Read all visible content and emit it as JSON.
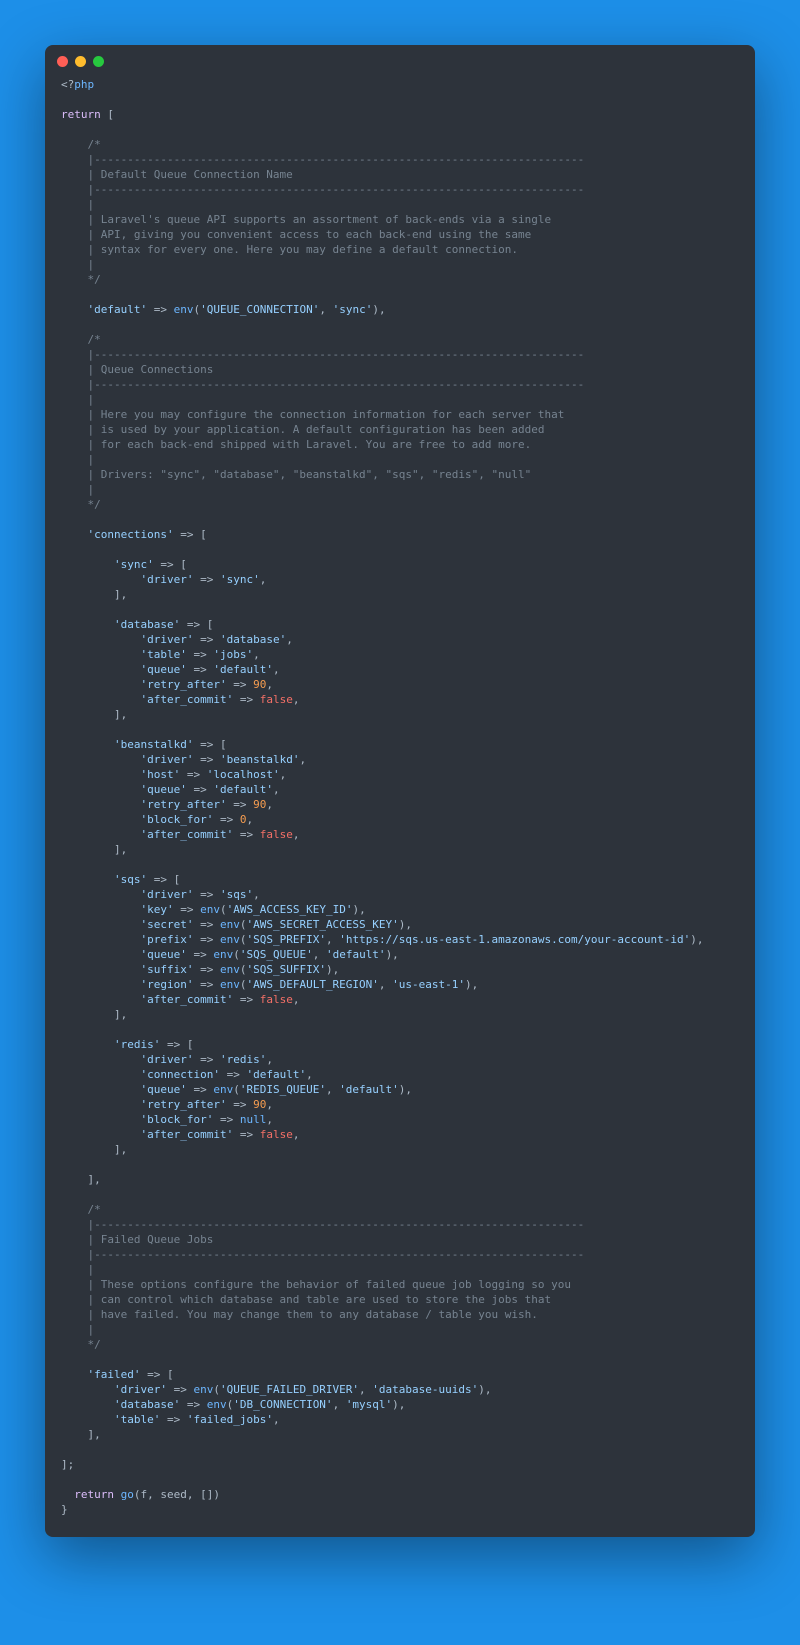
{
  "tag_open": "<?",
  "tag_lang": "php",
  "kw_return": "return",
  "open_bracket": "[",
  "cmt1_open": "/*",
  "cmt1_hr1": "|--------------------------------------------------------------------------",
  "cmt1_title": "| Default Queue Connection Name",
  "cmt1_hr2": "|--------------------------------------------------------------------------",
  "cmt1_pipe": "|",
  "cmt1_l1": "| Laravel's queue API supports an assortment of back-ends via a single",
  "cmt1_l2": "| API, giving you convenient access to each back-end using the same",
  "cmt1_l3": "| syntax for every one. Here you may define a default connection.",
  "cmt1_close": "*/",
  "default_key": "'default'",
  "env_fn": "env",
  "default_env_k": "'QUEUE_CONNECTION'",
  "default_env_v": "'sync'",
  "cmt2_open": "/*",
  "cmt2_hr1": "|--------------------------------------------------------------------------",
  "cmt2_title": "| Queue Connections",
  "cmt2_hr2": "|--------------------------------------------------------------------------",
  "cmt2_pipe": "|",
  "cmt2_l1": "| Here you may configure the connection information for each server that",
  "cmt2_l2": "| is used by your application. A default configuration has been added",
  "cmt2_l3": "| for each back-end shipped with Laravel. You are free to add more.",
  "cmt2_l4": "| Drivers: \"sync\", \"database\", \"beanstalkd\", \"sqs\", \"redis\", \"null\"",
  "cmt2_close": "*/",
  "connections_key": "'connections'",
  "arr_open": "[",
  "arr_close": "],",
  "arr_close_final": "],",
  "sync_name": "'sync'",
  "driver_key": "'driver'",
  "sync_driver": "'sync'",
  "db_name": "'database'",
  "db_driver": "'database'",
  "table_key": "'table'",
  "db_table": "'jobs'",
  "queue_key": "'queue'",
  "db_queue": "'default'",
  "retry_key": "'retry_after'",
  "num_90": "90",
  "after_commit_key": "'after_commit'",
  "bool_false": "false",
  "bs_name": "'beanstalkd'",
  "bs_driver": "'beanstalkd'",
  "host_key": "'host'",
  "bs_host": "'localhost'",
  "bs_queue": "'default'",
  "block_for_key": "'block_for'",
  "num_0": "0",
  "sqs_name": "'sqs'",
  "sqs_driver": "'sqs'",
  "key_key": "'key'",
  "sqs_key_env": "'AWS_ACCESS_KEY_ID'",
  "secret_key": "'secret'",
  "sqs_secret_env": "'AWS_SECRET_ACCESS_KEY'",
  "prefix_key": "'prefix'",
  "sqs_prefix_env": "'SQS_PREFIX'",
  "sqs_prefix_def": "'https://sqs.us-east-1.amazonaws.com/your-account-id'",
  "sqs_queue_env": "'SQS_QUEUE'",
  "sqs_queue_def": "'default'",
  "suffix_key": "'suffix'",
  "sqs_suffix_env": "'SQS_SUFFIX'",
  "region_key": "'region'",
  "sqs_region_env": "'AWS_DEFAULT_REGION'",
  "sqs_region_def": "'us-east-1'",
  "redis_name": "'redis'",
  "redis_driver": "'redis'",
  "connection_key": "'connection'",
  "redis_conn_v": "'default'",
  "redis_queue_env": "'REDIS_QUEUE'",
  "redis_queue_def": "'default'",
  "kw_null": "null",
  "cmt3_open": "/*",
  "cmt3_hr1": "|--------------------------------------------------------------------------",
  "cmt3_title": "| Failed Queue Jobs",
  "cmt3_hr2": "|--------------------------------------------------------------------------",
  "cmt3_pipe": "|",
  "cmt3_l1": "| These options configure the behavior of failed queue job logging so you",
  "cmt3_l2": "| can control which database and table are used to store the jobs that",
  "cmt3_l3": "| have failed. You may change them to any database / table you wish.",
  "cmt3_close": "*/",
  "failed_key": "'failed'",
  "failed_driver_env": "'QUEUE_FAILED_DRIVER'",
  "failed_driver_def": "'database-uuids'",
  "database_key": "'database'",
  "failed_db_env": "'DB_CONNECTION'",
  "failed_db_def": "'mysql'",
  "failed_table": "'failed_jobs'",
  "end_bracket": "];",
  "stray_return": "return",
  "stray_go": "go",
  "stray_args": "(f, seed, [])",
  "stray_brace": "}"
}
